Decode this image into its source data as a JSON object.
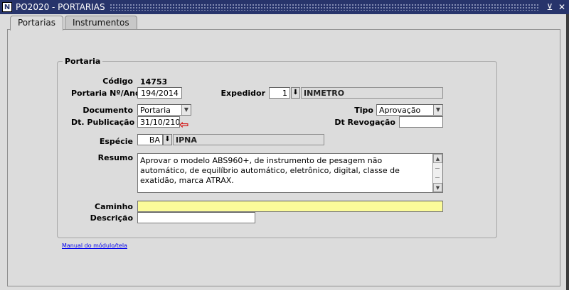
{
  "window": {
    "title": "PO2020 - PORTARIAS",
    "app_icon": "N",
    "minimize_icon": "⊻",
    "close_icon": "✕"
  },
  "tabs": [
    {
      "label": "Portarias",
      "active": true
    },
    {
      "label": "Instrumentos",
      "active": false
    }
  ],
  "group": {
    "title": "Portaria"
  },
  "form": {
    "codigo": {
      "label": "Código",
      "value": "14753"
    },
    "portaria_ano": {
      "label": "Portaria Nº/Ano",
      "value": "194/2014"
    },
    "expedidor": {
      "label": "Expedidor",
      "code": "1",
      "name": "INMETRO"
    },
    "documento": {
      "label": "Documento",
      "value": "Portaria"
    },
    "tipo": {
      "label": "Tipo",
      "value": "Aprovação"
    },
    "dt_publicacao": {
      "label": "Dt. Publicação",
      "value": "31/10/2104"
    },
    "dt_revogacao": {
      "label": "Dt Revogação",
      "value": ""
    },
    "especie": {
      "label": "Espécie",
      "code": "BA",
      "name": "IPNA"
    },
    "resumo": {
      "label": "Resumo",
      "value": "Aprovar o modelo ABS960+, de instrumento de pesagem não automático, de equilíbrio automático, eletrônico, digital, classe de exatidão, marca ATRAX."
    },
    "caminho": {
      "label": "Caminho",
      "value": ""
    },
    "descricao": {
      "label": "Descrição",
      "value": ""
    }
  },
  "footer": {
    "manual_link": "Manual do módulo/tela"
  },
  "colors": {
    "titlebar": "#27346b",
    "highlight_field": "#fbfb9a",
    "indicator_arrow": "#d31010"
  }
}
